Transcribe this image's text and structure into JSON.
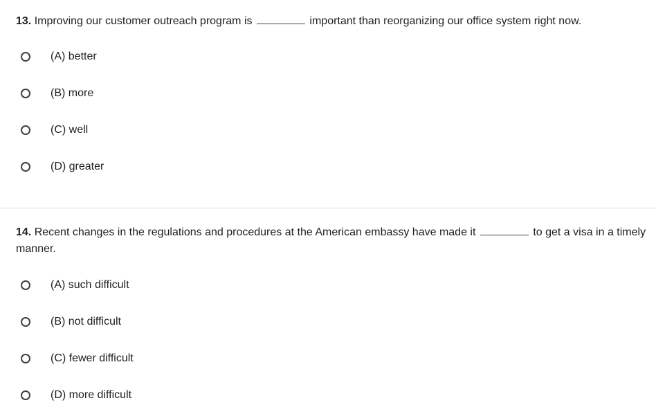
{
  "questions": [
    {
      "number": "13.",
      "text_before": "Improving our customer outreach program is",
      "text_after": "important than reorganizing our office system right now.",
      "options": [
        {
          "label": "(A) better"
        },
        {
          "label": "(B) more"
        },
        {
          "label": "(C) well"
        },
        {
          "label": "(D) greater"
        }
      ]
    },
    {
      "number": "14.",
      "text_before": "Recent changes in the regulations and procedures at the American embassy have made it",
      "text_after": "to get a visa in a timely manner.",
      "options": [
        {
          "label": "(A) such difficult"
        },
        {
          "label": "(B) not difficult"
        },
        {
          "label": "(C) fewer difficult"
        },
        {
          "label": "(D) more difficult"
        }
      ]
    }
  ]
}
